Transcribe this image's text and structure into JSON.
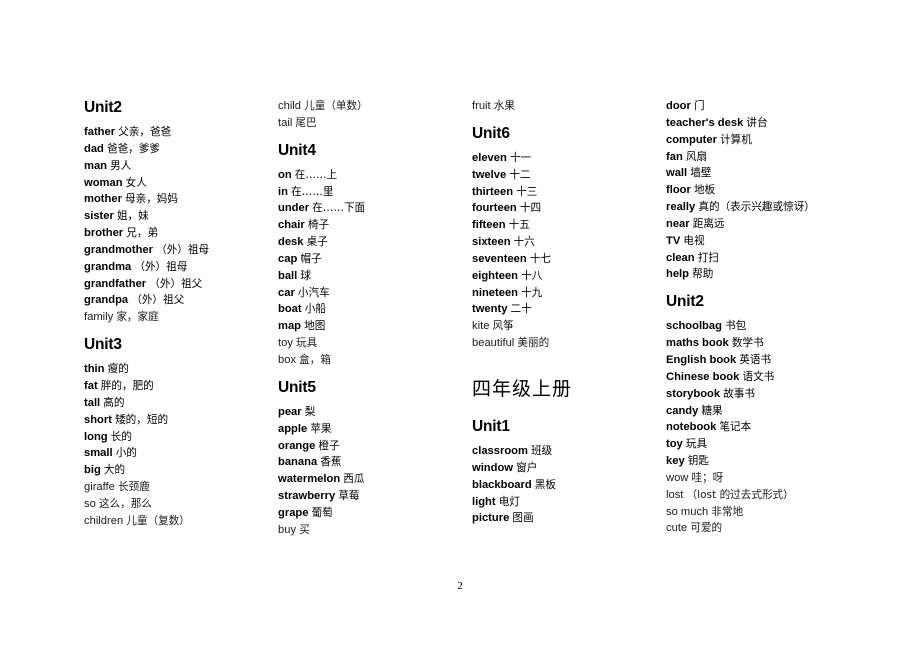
{
  "page": {
    "number": "2"
  },
  "columns": [
    {
      "blocks": [
        {
          "type": "unit",
          "heading": "Unit2",
          "entries": [
            {
              "word": "father",
              "cn": "父亲，爸爸",
              "weight": "bold"
            },
            {
              "word": "dad",
              "cn": "爸爸，爹爹",
              "weight": "bold"
            },
            {
              "word": "man",
              "cn": "男人",
              "weight": "bold"
            },
            {
              "word": "woman",
              "cn": "女人",
              "weight": "bold"
            },
            {
              "word": "mother",
              "cn": "母亲，妈妈",
              "weight": "bold"
            },
            {
              "word": "sister",
              "cn": "姐，妹",
              "weight": "bold"
            },
            {
              "word": "brother",
              "cn": "兄，弟",
              "weight": "bold"
            },
            {
              "word": "grandmother",
              "cn": "（外）祖母",
              "weight": "bold"
            },
            {
              "word": "grandma",
              "cn": "（外）祖母",
              "weight": "bold"
            },
            {
              "word": "grandfather",
              "cn": "（外）祖父",
              "weight": "bold"
            },
            {
              "word": "grandpa",
              "cn": "（外）祖父",
              "weight": "bold"
            },
            {
              "word": "family",
              "cn": "家，家庭",
              "weight": "light"
            }
          ]
        },
        {
          "type": "unit",
          "heading": "Unit3",
          "entries": [
            {
              "word": "thin",
              "cn": "瘦的",
              "weight": "bold"
            },
            {
              "word": "fat",
              "cn": "胖的，肥的",
              "weight": "bold"
            },
            {
              "word": "tall",
              "cn": "高的",
              "weight": "bold"
            },
            {
              "word": "short",
              "cn": "矮的，短的",
              "weight": "bold"
            },
            {
              "word": "long",
              "cn": "长的",
              "weight": "bold"
            },
            {
              "word": "small",
              "cn": "小的",
              "weight": "bold"
            },
            {
              "word": "big",
              "cn": "大的",
              "weight": "bold"
            },
            {
              "word": "giraffe",
              "cn": "长颈鹿",
              "weight": "light"
            },
            {
              "word": "so",
              "cn": "这么，那么",
              "weight": "light"
            },
            {
              "word": "children",
              "cn": "儿童（复数）",
              "weight": "light"
            }
          ]
        }
      ]
    },
    {
      "blocks": [
        {
          "type": "continuation",
          "heading": "",
          "entries": [
            {
              "word": "child",
              "cn": "儿童（单数）",
              "weight": "light"
            },
            {
              "word": "tail",
              "cn": "尾巴",
              "weight": "light"
            }
          ]
        },
        {
          "type": "unit",
          "heading": "Unit4",
          "entries": [
            {
              "word": "on",
              "cn": "在……上",
              "weight": "bold"
            },
            {
              "word": "in",
              "cn": "在……里",
              "weight": "bold"
            },
            {
              "word": "under",
              "cn": "在……下面",
              "weight": "bold"
            },
            {
              "word": "chair",
              "cn": "椅子",
              "weight": "bold"
            },
            {
              "word": "desk",
              "cn": "桌子",
              "weight": "bold"
            },
            {
              "word": "cap",
              "cn": "帽子",
              "weight": "bold"
            },
            {
              "word": "ball",
              "cn": "球",
              "weight": "bold"
            },
            {
              "word": "car",
              "cn": "小汽车",
              "weight": "bold"
            },
            {
              "word": "boat",
              "cn": "小船",
              "weight": "bold"
            },
            {
              "word": "map",
              "cn": "地图",
              "weight": "bold"
            },
            {
              "word": "toy",
              "cn": "玩具",
              "weight": "light"
            },
            {
              "word": "box",
              "cn": "盒，箱",
              "weight": "light"
            }
          ]
        },
        {
          "type": "unit",
          "heading": "Unit5",
          "entries": [
            {
              "word": "pear",
              "cn": "梨",
              "weight": "bold"
            },
            {
              "word": "apple",
              "cn": "苹果",
              "weight": "bold"
            },
            {
              "word": "orange",
              "cn": "橙子",
              "weight": "bold"
            },
            {
              "word": "banana",
              "cn": "香蕉",
              "weight": "bold"
            },
            {
              "word": "watermelon",
              "cn": "西瓜",
              "weight": "bold"
            },
            {
              "word": "strawberry",
              "cn": "草莓",
              "weight": "bold"
            },
            {
              "word": "grape",
              "cn": "葡萄",
              "weight": "bold"
            },
            {
              "word": "buy",
              "cn": "买",
              "weight": "light"
            }
          ]
        }
      ]
    },
    {
      "blocks": [
        {
          "type": "continuation",
          "heading": "",
          "entries": [
            {
              "word": "fruit",
              "cn": "水果",
              "weight": "light"
            }
          ]
        },
        {
          "type": "unit",
          "heading": "Unit6",
          "entries": [
            {
              "word": "eleven",
              "cn": "十一",
              "weight": "bold"
            },
            {
              "word": "twelve",
              "cn": "十二",
              "weight": "bold"
            },
            {
              "word": "thirteen",
              "cn": "十三",
              "weight": "bold"
            },
            {
              "word": "fourteen",
              "cn": "十四",
              "weight": "bold"
            },
            {
              "word": "fifteen",
              "cn": "十五",
              "weight": "bold"
            },
            {
              "word": "sixteen",
              "cn": "十六",
              "weight": "bold"
            },
            {
              "word": "seventeen",
              "cn": "十七",
              "weight": "bold"
            },
            {
              "word": "eighteen",
              "cn": "十八",
              "weight": "bold"
            },
            {
              "word": "nineteen",
              "cn": "十九",
              "weight": "bold"
            },
            {
              "word": "twenty",
              "cn": "二十",
              "weight": "bold"
            },
            {
              "word": "kite",
              "cn": "风筝",
              "weight": "light"
            },
            {
              "word": "beautiful",
              "cn": "美丽的",
              "weight": "light"
            }
          ]
        },
        {
          "type": "book",
          "heading": "四年级上册",
          "entries": []
        },
        {
          "type": "unit",
          "heading": "Unit1",
          "entries": [
            {
              "word": "classroom",
              "cn": "班级",
              "weight": "bold"
            },
            {
              "word": "window",
              "cn": "窗户",
              "weight": "bold"
            },
            {
              "word": "blackboard",
              "cn": "黑板",
              "weight": "bold"
            },
            {
              "word": "light",
              "cn": "电灯",
              "weight": "bold"
            },
            {
              "word": "picture",
              "cn": "图画",
              "weight": "bold"
            }
          ]
        }
      ]
    },
    {
      "blocks": [
        {
          "type": "continuation",
          "heading": "",
          "entries": [
            {
              "word": "door",
              "cn": "门",
              "weight": "bold"
            },
            {
              "word": "teacher's desk",
              "cn": "讲台",
              "weight": "bold"
            },
            {
              "word": "computer",
              "cn": "计算机",
              "weight": "bold"
            },
            {
              "word": "fan",
              "cn": "风扇",
              "weight": "bold"
            },
            {
              "word": "wall",
              "cn": "墙壁",
              "weight": "bold"
            },
            {
              "word": "floor",
              "cn": "地板",
              "weight": "bold"
            },
            {
              "word": "really",
              "cn": "真的（表示兴趣或惊讶）",
              "weight": "bold"
            },
            {
              "word": "near",
              "cn": "距离远",
              "weight": "bold"
            },
            {
              "word": "TV",
              "cn": "电视",
              "weight": "bold"
            },
            {
              "word": "clean",
              "cn": "打扫",
              "weight": "bold"
            },
            {
              "word": "help",
              "cn": "帮助",
              "weight": "bold"
            }
          ]
        },
        {
          "type": "unit",
          "heading": "Unit2",
          "entries": [
            {
              "word": "schoolbag",
              "cn": "书包",
              "weight": "bold"
            },
            {
              "word": "maths book",
              "cn": "数学书",
              "weight": "bold"
            },
            {
              "word": "English book",
              "cn": "英语书",
              "weight": "bold"
            },
            {
              "word": "Chinese book",
              "cn": "语文书",
              "weight": "bold"
            },
            {
              "word": "storybook",
              "cn": "故事书",
              "weight": "bold"
            },
            {
              "word": "candy",
              "cn": "糖果",
              "weight": "bold"
            },
            {
              "word": "notebook",
              "cn": "笔记本",
              "weight": "bold"
            },
            {
              "word": "toy",
              "cn": "玩具",
              "weight": "bold"
            },
            {
              "word": "key",
              "cn": "钥匙",
              "weight": "bold"
            },
            {
              "word": "wow",
              "cn": "哇；呀",
              "weight": "light"
            },
            {
              "word": "lost",
              "cn": "（lost 的过去式形式）",
              "weight": "light"
            },
            {
              "word": "so much",
              "cn": "非常地",
              "weight": "light"
            },
            {
              "word": "cute",
              "cn": "可爱的",
              "weight": "light"
            }
          ]
        }
      ]
    }
  ]
}
